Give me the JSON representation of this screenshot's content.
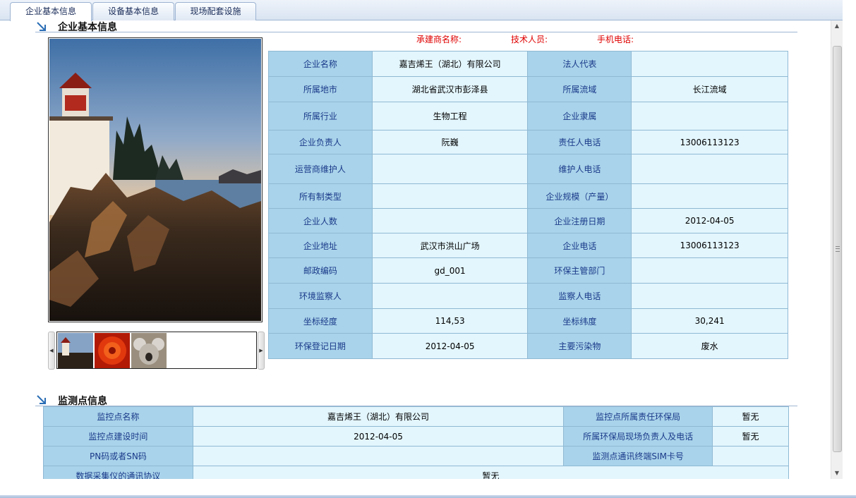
{
  "tabs": [
    {
      "label": "企业基本信息",
      "active": true
    },
    {
      "label": "设备基本信息",
      "active": false
    },
    {
      "label": "现场配套设施",
      "active": false
    }
  ],
  "company_section": {
    "title": "企业基本信息",
    "contact": {
      "contractor_label": "承建商名称:",
      "tech_label": "技术人员:",
      "phone_label": "手机电话:"
    },
    "rows": [
      [
        "企业名称",
        "嘉吉烯王（湖北）有限公司",
        "法人代表",
        ""
      ],
      [
        "所属地市",
        "湖北省武汉市彭泽县",
        "所属流域",
        "长江流域"
      ],
      [
        "所属行业",
        "生物工程",
        "企业隶属",
        ""
      ],
      [
        "企业负责人",
        "阮巍",
        "责任人电话",
        "13006113123"
      ],
      [
        "运营商维护人",
        "",
        "维护人电话",
        ""
      ],
      [
        "所有制类型",
        "",
        "企业规模（产量）",
        ""
      ],
      [
        "企业人数",
        "",
        "企业注册日期",
        "2012-04-05"
      ],
      [
        "企业地址",
        "武汉市洪山广场",
        "企业电话",
        "13006113123"
      ],
      [
        "邮政编码",
        "gd_001",
        "环保主管部门",
        ""
      ],
      [
        "环境监察人",
        "",
        "监察人电话",
        ""
      ],
      [
        "坐标经度",
        "114,53",
        "坐标纬度",
        "30,241"
      ],
      [
        "环保登记日期",
        "2012-04-05",
        "主要污染物",
        "废水"
      ]
    ]
  },
  "monitor_section": {
    "title": "监测点信息",
    "rows": [
      [
        "监控点名称",
        "嘉吉烯王（湖北）有限公司",
        "监控点所属责任环保局",
        "暂无"
      ],
      [
        "监控点建设时间",
        "2012-04-05",
        "所属环保局现场负责人及电话",
        "暂无"
      ],
      [
        "PN码或者SN码",
        "",
        "监测点通讯终端SIM卡号",
        ""
      ],
      [
        "数据采集仪的通讯协议",
        "暂无"
      ]
    ]
  },
  "icons": {
    "section_arrow": "arrow-down-right-icon",
    "scroll_up": "triangle-up-icon",
    "scroll_down": "triangle-down-icon",
    "thumb_prev": "triangle-left-icon",
    "thumb_next": "triangle-right-icon"
  },
  "colors": {
    "key_cell": "#a9d3ea",
    "value_cell": "#e3f6fd",
    "contact_text": "#e00000",
    "section_arrow": "#2a6db5"
  }
}
